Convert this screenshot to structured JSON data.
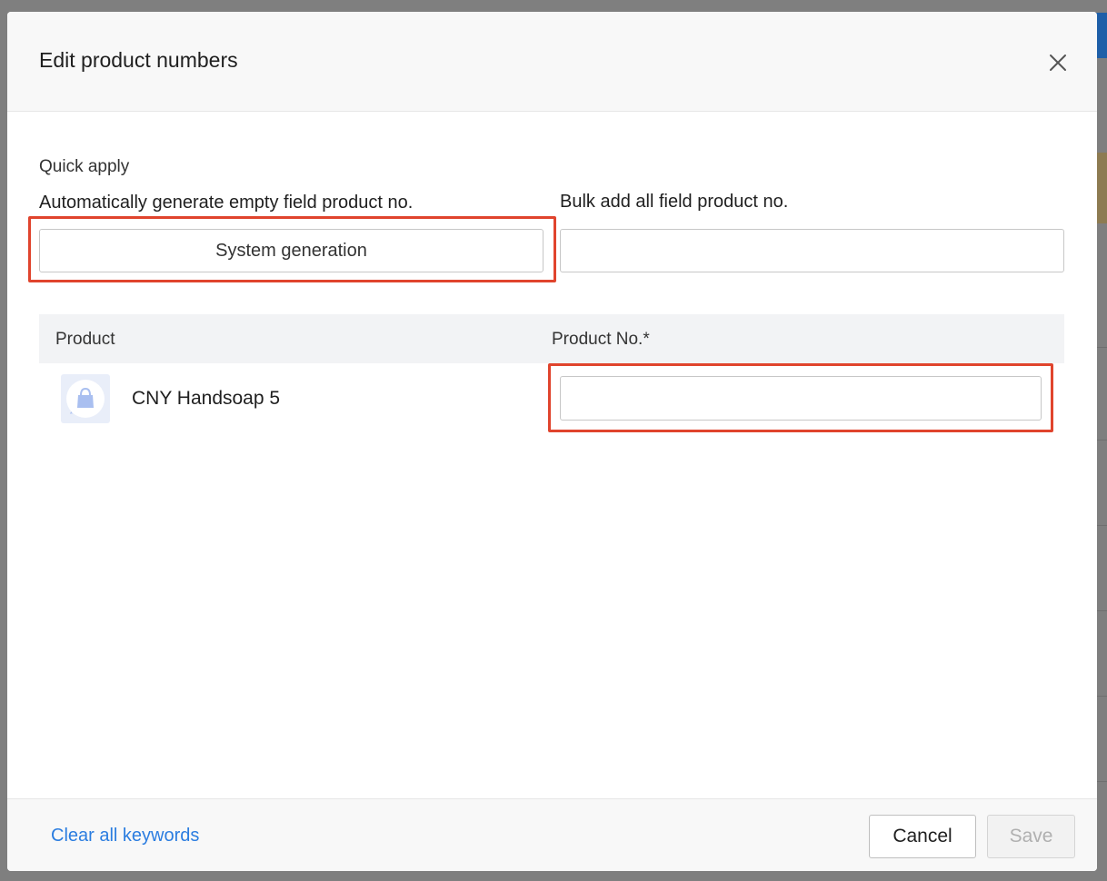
{
  "modal": {
    "title": "Edit product numbers"
  },
  "quick_apply": {
    "heading": "Quick apply",
    "generate_label": "Automatically generate empty field product no.",
    "generate_button": "System generation",
    "bulk_label": "Bulk add all field product no.",
    "bulk_value": "",
    "bulk_placeholder": ""
  },
  "table": {
    "headers": [
      "Product",
      "Product No.*"
    ],
    "rows": [
      {
        "name": "CNY Handsoap 5",
        "product_no": "",
        "thumbnail_icon": "shopping-bag-icon"
      }
    ]
  },
  "footer": {
    "clear_label": "Clear all keywords",
    "cancel_label": "Cancel",
    "save_label": "Save"
  },
  "colors": {
    "highlight": "#e0442d",
    "link": "#2b7de0",
    "thumbnail_bg": "#e9eef9"
  }
}
